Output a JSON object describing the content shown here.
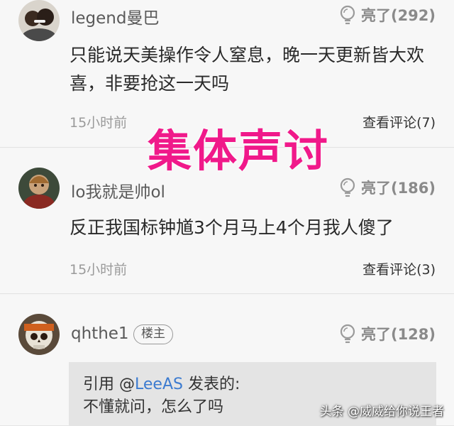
{
  "comments": [
    {
      "username": "legend曼巴",
      "likes": "亮了(292)",
      "text": "只能说天美操作令人窒息，晚一天更新皆大欢喜，非要抢这一天吗",
      "time": "15小时前",
      "replies": "查看评论(7)",
      "avatar_icon": "avatar-photo-icon"
    },
    {
      "username": "lo我就是帅ol",
      "likes": "亮了(186)",
      "text": "反正我国标钟馗3个月马上4个月我人傻了",
      "time": "15小时前",
      "replies": "查看评论(3)",
      "avatar_icon": "avatar-character-icon"
    },
    {
      "username": "qhthe1",
      "badge": "楼主",
      "likes": "亮了(128)",
      "quote_prefix": "引用 @",
      "quote_mention": "LeeAS",
      "quote_suffix": " 发表的:",
      "quote_text": "不懂就问，怎么了吗",
      "avatar_icon": "avatar-skull-icon"
    }
  ],
  "overlay_caption": "集体声讨",
  "watermark": "头条 @威威给你说王者",
  "like_icon": "lightbulb-icon",
  "colors": {
    "caption": "#f0198a",
    "mention": "#3c7bd0",
    "background": "#f7f7f7"
  }
}
